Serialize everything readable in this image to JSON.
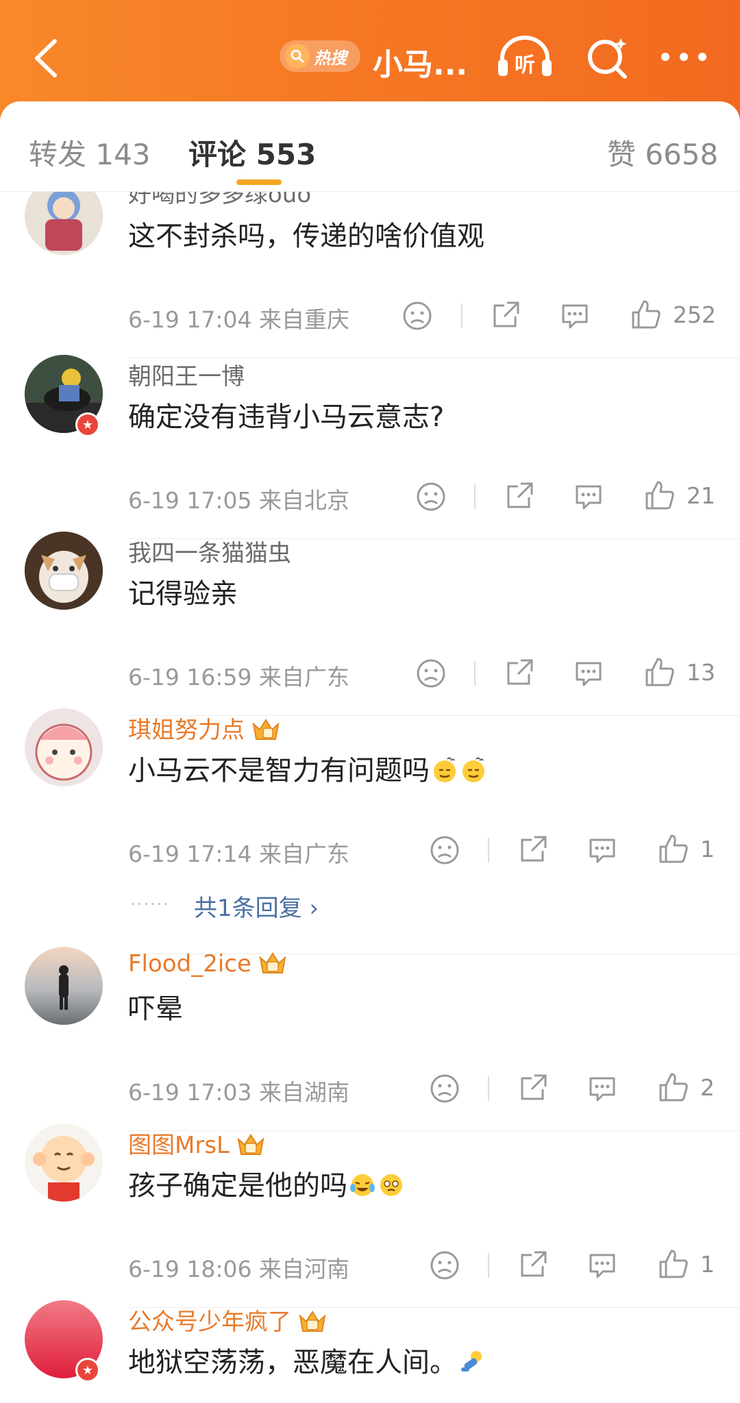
{
  "header": {
    "hot_label": "热搜",
    "title": "小马...",
    "listen_label": "听",
    "accent": "#f67a24"
  },
  "tabs": [
    {
      "label": "转发 143"
    },
    {
      "label": "评论 553",
      "active": true
    },
    {
      "label": "赞 6658"
    }
  ],
  "comments": [
    {
      "username": "好喝的多多绿ouo",
      "text": "这不封杀吗，传递的啥价值观",
      "time": "6-19 17:04",
      "location": "来自重庆",
      "likes": "252"
    },
    {
      "username": "朝阳王一博",
      "text": "确定没有违背小马云意志?",
      "time": "6-19 17:05",
      "location": "来自北京",
      "likes": "21"
    },
    {
      "username": "我四一条猫猫虫",
      "text": "记得验亲",
      "time": "6-19 16:59",
      "location": "来自广东",
      "likes": "13"
    },
    {
      "username": "琪姐努力点",
      "text": "小马云不是智力有问题吗",
      "time": "6-19 17:14",
      "location": "来自广东",
      "likes": "1",
      "replies": "共1条回复 ›"
    },
    {
      "username": "Flood_2ice",
      "text": "吓晕",
      "time": "6-19 17:03",
      "location": "来自湖南",
      "likes": "2"
    },
    {
      "username": "图图MrsL",
      "text": "孩子确定是他的吗",
      "time": "6-19 18:06",
      "location": "来自河南",
      "likes": "1"
    },
    {
      "username": "公众号少年疯了",
      "text": "地狱空荡荡，恶魔在人间。"
    }
  ],
  "icons": {
    "dislike": "frown-face-icon",
    "share": "share-icon",
    "comment": "comment-bubble-icon",
    "like": "thumb-up-icon"
  }
}
